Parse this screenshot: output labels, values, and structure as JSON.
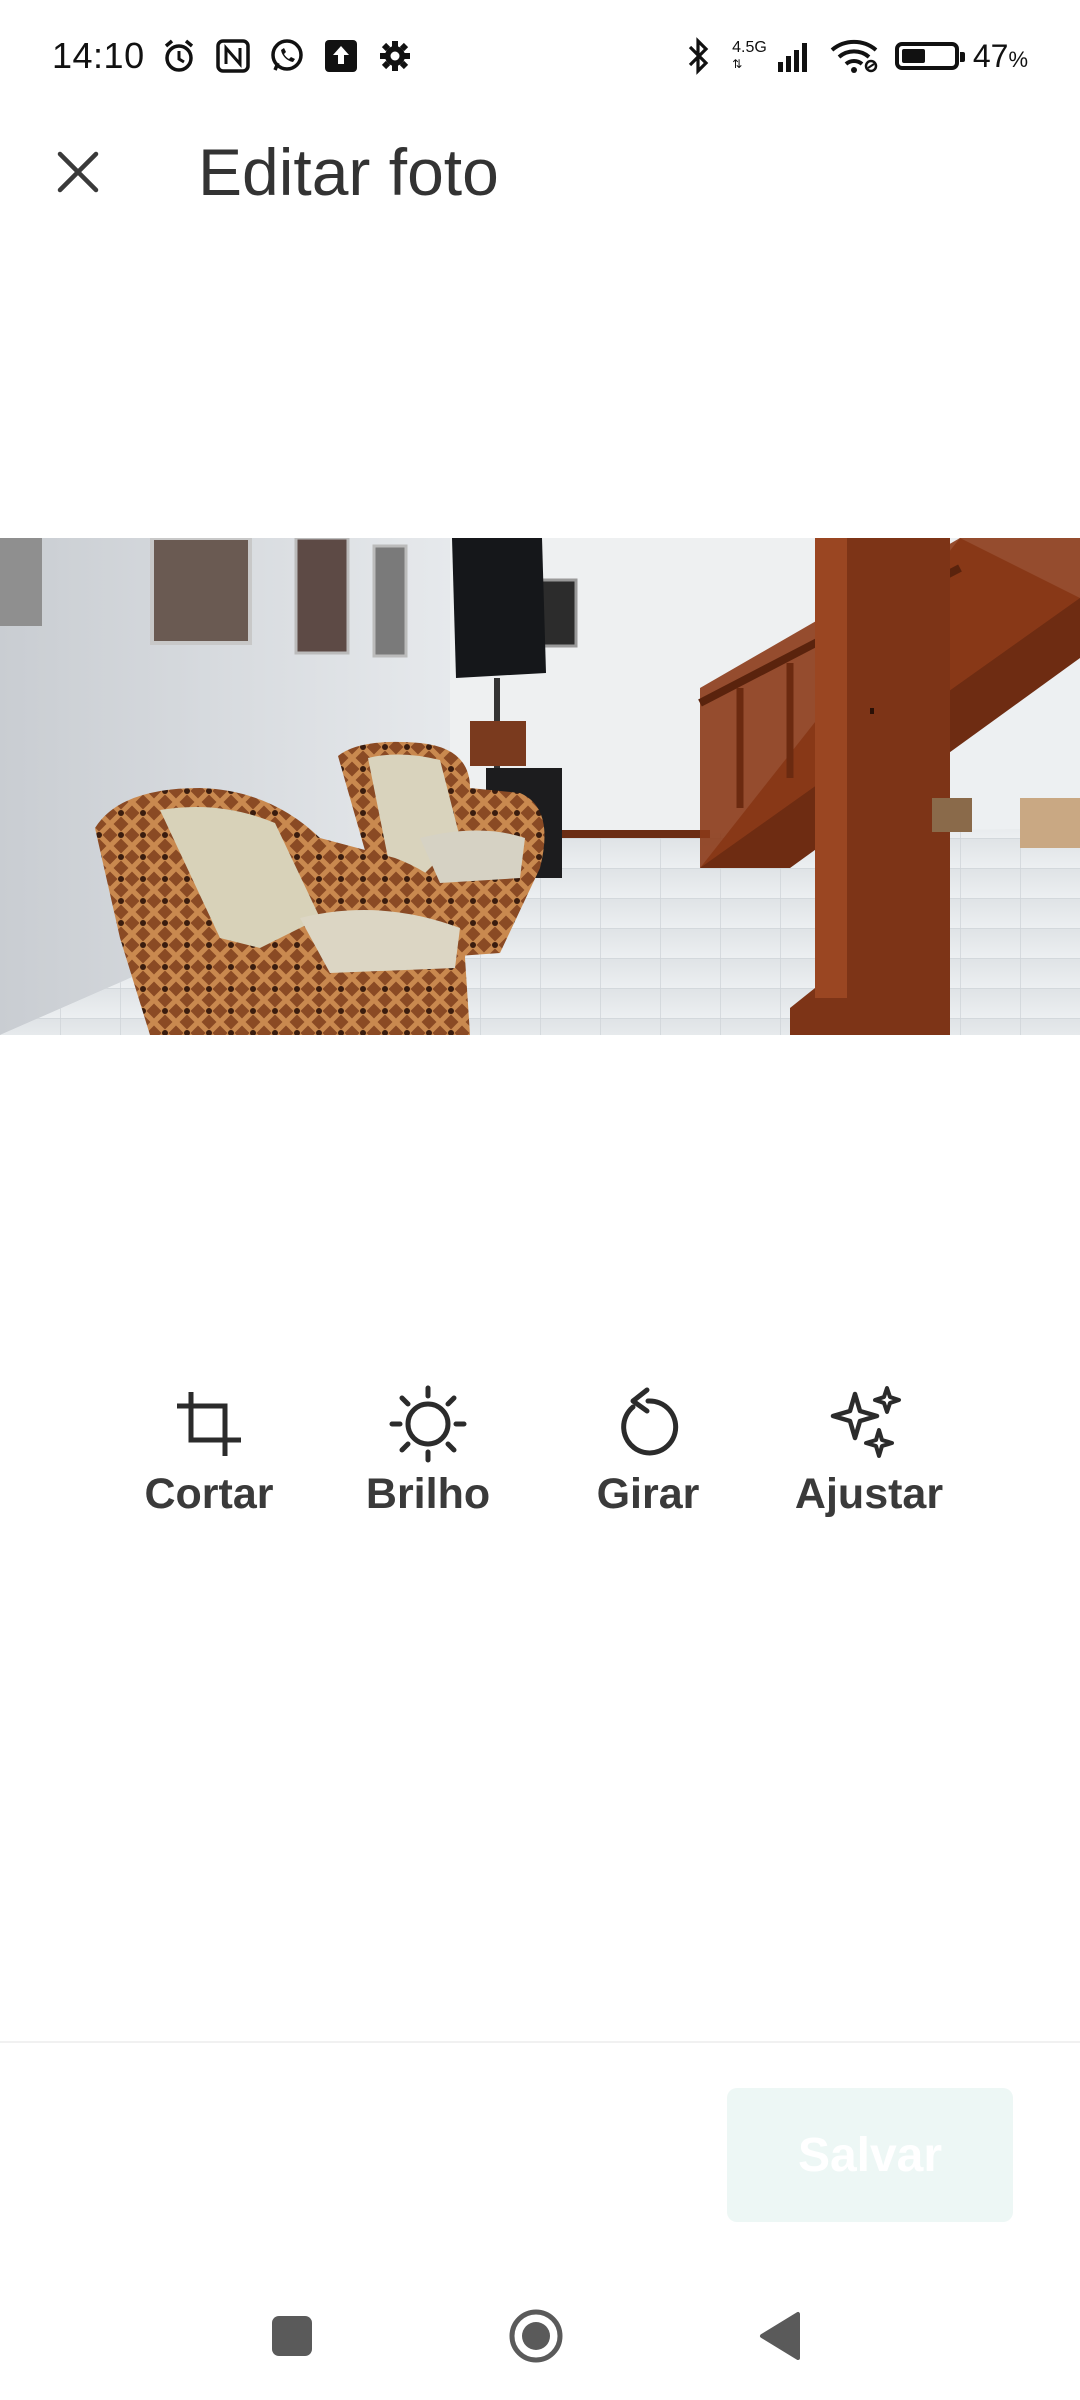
{
  "status_bar": {
    "time": "14:10",
    "network_label": "4.5G",
    "battery_percent": "47",
    "battery_suffix": "%",
    "battery_level": 0.47,
    "left_icons": [
      "alarm-icon",
      "nfc-icon",
      "whatsapp-icon",
      "upload-icon",
      "settings-gear-icon"
    ],
    "right_icons": [
      "bluetooth-icon",
      "signal-icon",
      "wifi-icon",
      "battery-icon"
    ]
  },
  "header": {
    "close_icon": "close-icon",
    "title": "Editar foto"
  },
  "photo": {
    "subject": "wicker-chairs-room-staircase"
  },
  "tools": [
    {
      "label": "Cortar",
      "icon": "crop-icon"
    },
    {
      "label": "Brilho",
      "icon": "brightness-icon"
    },
    {
      "label": "Girar",
      "icon": "rotate-icon"
    },
    {
      "label": "Ajustar",
      "icon": "sparkle-icon"
    }
  ],
  "actions": {
    "save_label": "Salvar",
    "save_enabled": false
  },
  "nav_bar": {
    "buttons": [
      "recents-square-icon",
      "home-circle-icon",
      "back-triangle-icon"
    ]
  },
  "colors": {
    "text": "#333333",
    "save_disabled_bg": "#edf7f5",
    "wood": "#7a3a1e",
    "wall": "#e9ecef"
  }
}
